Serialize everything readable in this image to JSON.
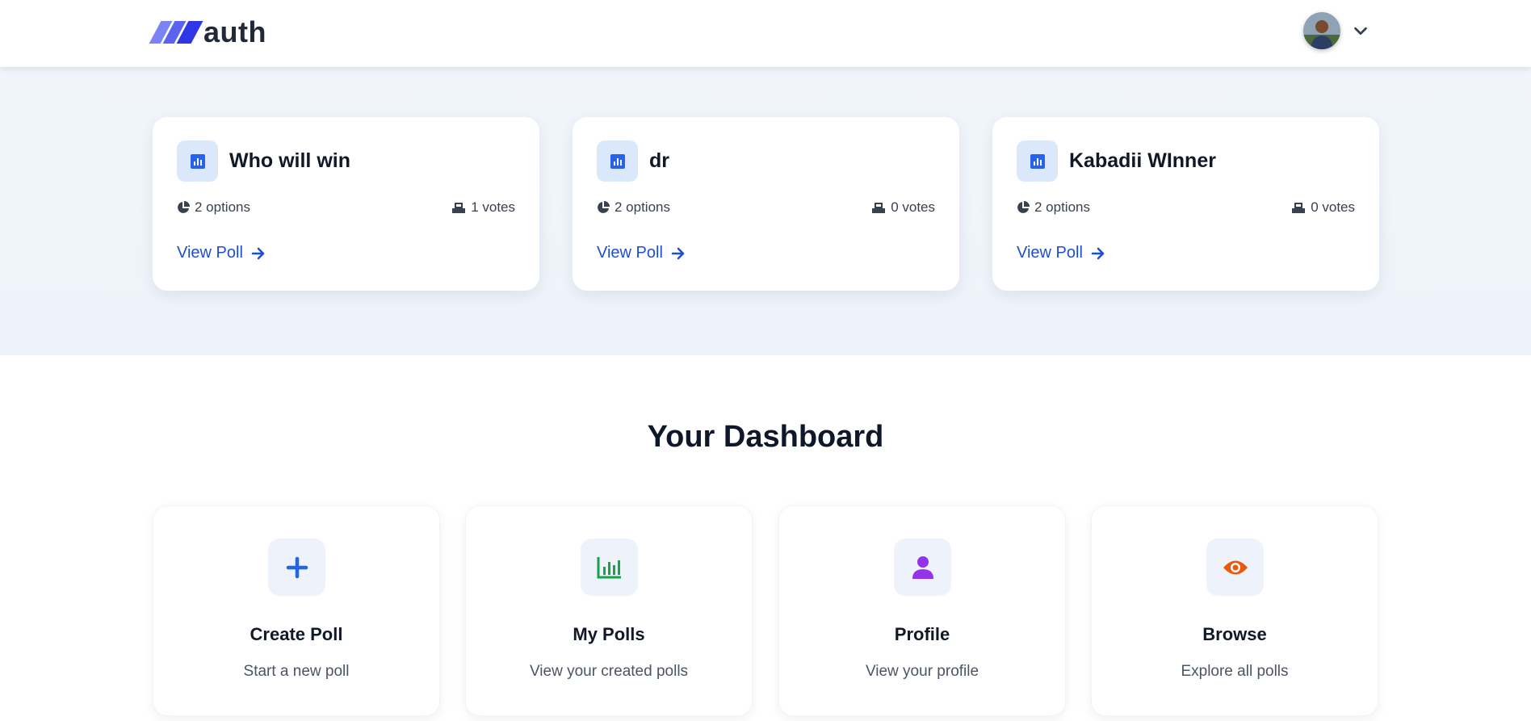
{
  "header": {
    "logo_text": "auth",
    "user_avatar_alt": "User avatar"
  },
  "polls": [
    {
      "title": "Who will win",
      "options": "2 options",
      "votes": "1 votes",
      "link": "View Poll"
    },
    {
      "title": "dr",
      "options": "2 options",
      "votes": "0 votes",
      "link": "View Poll"
    },
    {
      "title": "Kabadii WInner",
      "options": "2 options",
      "votes": "0 votes",
      "link": "View Poll"
    }
  ],
  "dashboard": {
    "title": "Your Dashboard",
    "cards": [
      {
        "label": "Create Poll",
        "sub": "Start a new poll",
        "icon": "plus-icon",
        "color": "#2563eb"
      },
      {
        "label": "My Polls",
        "sub": "View your created polls",
        "icon": "chart-icon",
        "color": "#16a34a"
      },
      {
        "label": "Profile",
        "sub": "View your profile",
        "icon": "user-icon",
        "color": "#9333ea"
      },
      {
        "label": "Browse",
        "sub": "Explore all polls",
        "icon": "eye-icon",
        "color": "#ea580c"
      }
    ]
  },
  "colors": {
    "accent": "#1d4ed8",
    "band_bg": "#eef3fb"
  }
}
